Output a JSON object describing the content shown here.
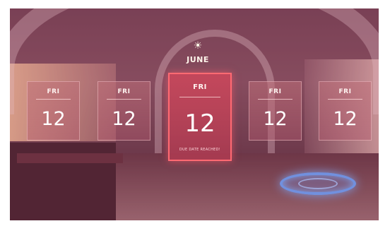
{
  "header": {
    "icon": "sun-icon",
    "month": "JUNE"
  },
  "calendar": {
    "cards": [
      {
        "day": "FRI",
        "date": "12"
      },
      {
        "day": "FRI",
        "date": "12"
      },
      {
        "day": "FRI",
        "date": "12",
        "note": "DUE DATE REACHED!"
      },
      {
        "day": "FRI",
        "date": "12"
      },
      {
        "day": "FRI",
        "date": "12"
      }
    ]
  },
  "colors": {
    "active_border": "#ff6a72",
    "portal": "#6fa8ff"
  }
}
